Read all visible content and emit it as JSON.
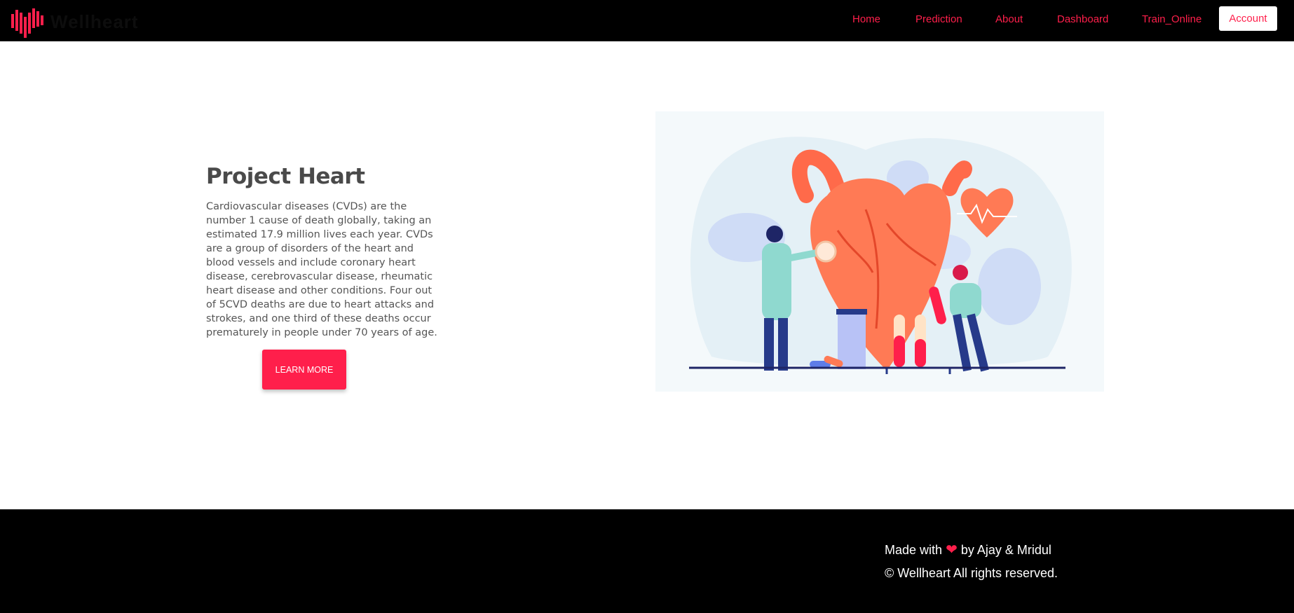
{
  "brand": {
    "name": "Wellheart",
    "accent_color": "#ff1f4b"
  },
  "nav": {
    "links": [
      "Home",
      "Prediction",
      "About",
      "Dashboard",
      "Train_Online"
    ],
    "account_label": "Account"
  },
  "hero": {
    "title": "Project Heart",
    "description": "Cardiovascular diseases (CVDs) are the number 1 cause of death globally, taking an estimated 17.9 million lives each year. CVDs are a group of disorders of the heart and blood vessels and include coronary heart disease, cerebrovascular disease, rheumatic heart disease and other conditions. Four out of 5CVD deaths are due to heart attacks and strokes, and one third of these deaths occur prematurely in people under 70 years of age.",
    "button_label": "LEARN MORE",
    "illustration_icon": "doctors-heart-illustration"
  },
  "footer": {
    "made_with_prefix": "Made with",
    "heart_icon": "heart-icon",
    "made_with_suffix": "by Ajay & Mridul",
    "copyright": "© Wellheart All rights reserved."
  }
}
